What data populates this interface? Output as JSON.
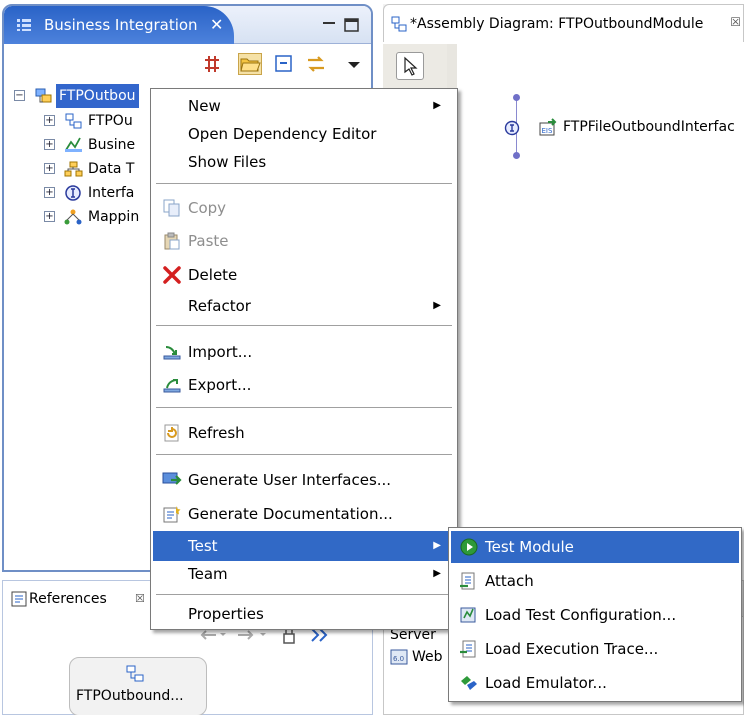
{
  "business_integration": {
    "title": "Business Integration",
    "close_glyph": "✕",
    "toolbar_icons": [
      "grid-icon",
      "open-folder-icon",
      "collapse-icon",
      "sync-icon",
      "view-menu-icon"
    ],
    "tree": [
      {
        "label": "FTPOutbou",
        "icon": "module-icon",
        "expanded": true,
        "selected": true
      },
      {
        "label": "FTPOu",
        "icon": "assembly-icon",
        "expanded": false
      },
      {
        "label": "Busine",
        "icon": "business-logic-icon",
        "expanded": false
      },
      {
        "label": "Data T",
        "icon": "data-types-icon",
        "expanded": false
      },
      {
        "label": "Interfa",
        "icon": "interface-icon",
        "expanded": false
      },
      {
        "label": "Mappin",
        "icon": "mapping-icon",
        "expanded": false
      }
    ]
  },
  "editor": {
    "title": "*Assembly Diagram: FTPOutboundModule",
    "close_glyph": "☒",
    "component_label": "FTPFileOutboundInterfac"
  },
  "references": {
    "title": "References",
    "close_glyph": "☒",
    "node_label": "FTPOutbound..."
  },
  "servers": {
    "header": "Server",
    "row_label": "Web"
  },
  "context_menu": {
    "items": [
      {
        "label": "New",
        "icon": "",
        "submenu": true,
        "disabled": false
      },
      {
        "label": "Open Dependency Editor",
        "icon": "",
        "submenu": false,
        "disabled": false
      },
      {
        "label": "Show Files",
        "icon": "",
        "submenu": false,
        "disabled": false
      },
      {
        "label": "Copy",
        "icon": "copy-icon",
        "submenu": false,
        "disabled": true
      },
      {
        "label": "Paste",
        "icon": "paste-icon",
        "submenu": false,
        "disabled": true
      },
      {
        "label": "Delete",
        "icon": "delete-icon",
        "submenu": false,
        "disabled": false
      },
      {
        "label": "Refactor",
        "icon": "",
        "submenu": true,
        "disabled": false
      },
      {
        "label": "Import...",
        "icon": "import-icon",
        "submenu": false,
        "disabled": false
      },
      {
        "label": "Export...",
        "icon": "export-icon",
        "submenu": false,
        "disabled": false
      },
      {
        "label": "Refresh",
        "icon": "refresh-icon",
        "submenu": false,
        "disabled": false
      },
      {
        "label": "Generate User Interfaces...",
        "icon": "generate-ui-icon",
        "submenu": false,
        "disabled": false
      },
      {
        "label": "Generate Documentation...",
        "icon": "generate-doc-icon",
        "submenu": false,
        "disabled": false
      },
      {
        "label": "Test",
        "icon": "",
        "submenu": true,
        "disabled": false,
        "highlighted": true
      },
      {
        "label": "Team",
        "icon": "",
        "submenu": true,
        "disabled": false
      },
      {
        "label": "Properties",
        "icon": "",
        "submenu": false,
        "disabled": false
      }
    ]
  },
  "test_submenu": {
    "items": [
      {
        "label": "Test Module",
        "icon": "test-module-icon",
        "highlighted": true
      },
      {
        "label": "Attach",
        "icon": "attach-icon"
      },
      {
        "label": "Load Test Configuration...",
        "icon": "load-test-config-icon"
      },
      {
        "label": "Load Execution Trace...",
        "icon": "load-trace-icon"
      },
      {
        "label": "Load Emulator...",
        "icon": "load-emulator-icon"
      }
    ]
  },
  "colors": {
    "selection": "#3169c6",
    "active_tab": "#2a63c7",
    "disabled_text": "#8e8e8e",
    "delete_icon": "#d42020"
  }
}
